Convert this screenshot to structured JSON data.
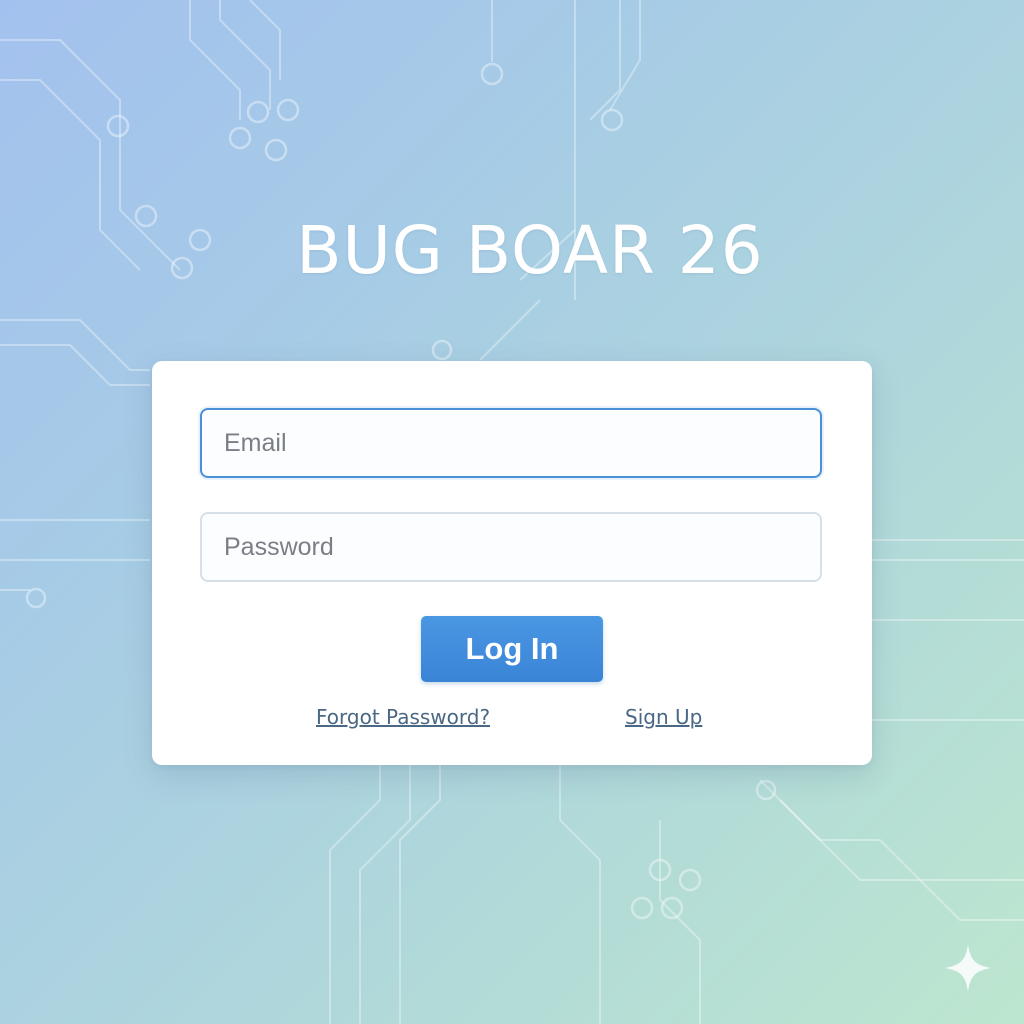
{
  "brand": {
    "title": "BUG BOAR 26"
  },
  "login_form": {
    "email_placeholder": "Email",
    "password_placeholder": "Password",
    "login_label": "Log In",
    "forgot_password_label": "Forgot Password?",
    "sign_up_label": "Sign Up"
  },
  "colors": {
    "accent": "#3a8ad9",
    "input_focus_border": "#4a90d9",
    "link": "#4a6884",
    "card_background": "#ffffff"
  },
  "icons": {
    "corner": "sparkle-icon"
  }
}
